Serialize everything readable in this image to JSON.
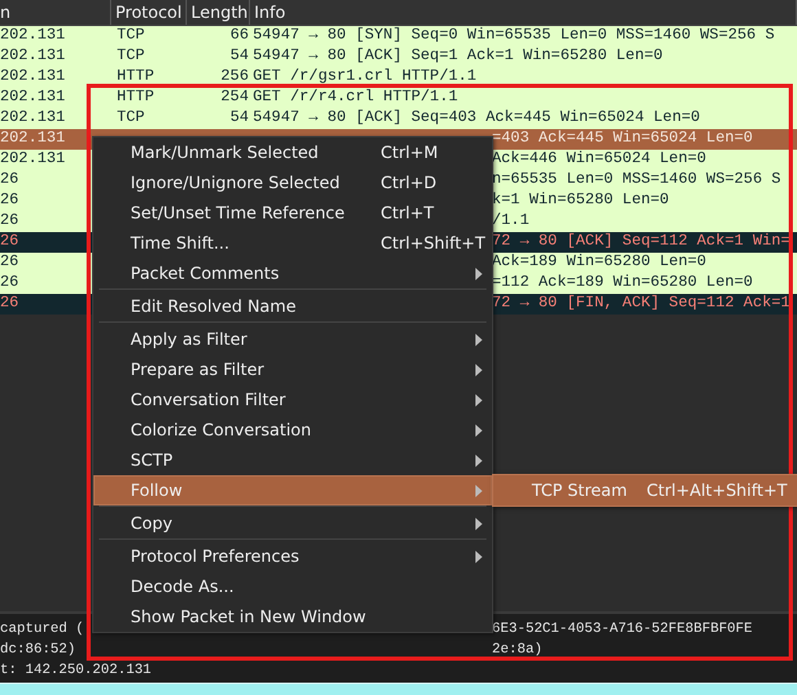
{
  "packet_list": {
    "columns": [
      "n",
      "Protocol",
      "Length",
      "Info"
    ],
    "rows": [
      {
        "cells": [
          "202.131",
          "TCP",
          "66",
          "54947 → 80 [SYN] Seq=0 Win=65535 Len=0 MSS=1460 WS=256 S"
        ],
        "color": "#e4ffc7",
        "selected": false
      },
      {
        "cells": [
          "202.131",
          "TCP",
          "54",
          "54947 → 80 [ACK] Seq=1 Ack=1 Win=65280 Len=0"
        ],
        "color": "#e4ffc7",
        "selected": false
      },
      {
        "cells": [
          "202.131",
          "HTTP",
          "256",
          "GET /r/gsr1.crl HTTP/1.1"
        ],
        "color": "#e4ffc7",
        "selected": false
      },
      {
        "cells": [
          "202.131",
          "HTTP",
          "254",
          "GET /r/r4.crl HTTP/1.1"
        ],
        "color": "#e4ffc7",
        "selected": false
      },
      {
        "cells": [
          "202.131",
          "TCP",
          "54",
          "54947 → 80 [ACK] Seq=403 Ack=445 Win=65024 Len=0"
        ],
        "color": "#e4ffc7",
        "selected": false
      },
      {
        "cells": [
          "202.131",
          "=403 Ack=445 Win=65024 Len=0"
        ],
        "selected": true
      },
      {
        "cells": [
          "202.131",
          "Ack=446 Win=65024 Len=0"
        ],
        "color": "#e4ffc7",
        "selected": false
      },
      {
        "cells": [
          "26",
          "n=65535 Len=0 MSS=1460 WS=256 S"
        ],
        "color": "#e4ffc7",
        "selected": false
      },
      {
        "cells": [
          "26",
          "k=1 Win=65280 Len=0"
        ],
        "color": "#e4ffc7",
        "selected": false
      },
      {
        "cells": [
          "26",
          "/1.1"
        ],
        "color": "#e4ffc7",
        "selected": false
      },
      {
        "cells": [
          "26",
          "72 → 80 [ACK] Seq=112 Ack=1 Win="
        ],
        "color": "#12272e",
        "selected": false
      },
      {
        "cells": [
          "26",
          "Ack=189 Win=65280 Len=0"
        ],
        "color": "#e4ffc7",
        "selected": false
      },
      {
        "cells": [
          "26",
          "=112 Ack=189 Win=65280 Len=0"
        ],
        "color": "#e4ffc7",
        "selected": false
      },
      {
        "cells": [
          "26",
          "72 → 80 [FIN, ACK] Seq=112 Ack=1"
        ],
        "color": "#12272e",
        "selected": false
      }
    ]
  },
  "packet_details": [
    [
      "captured (",
      "6E3-52C1-4053-A716-52FE8BFBF0FE"
    ],
    [
      "dc:86:52)",
      "2e:8a)"
    ],
    [
      "t: 142.250.202.131"
    ]
  ],
  "context_menu": [
    {
      "kind": "item",
      "label": "Mark/Unmark Selected",
      "shortcut": "Ctrl+M",
      "submenu": false,
      "selected": false
    },
    {
      "kind": "item",
      "label": "Ignore/Unignore Selected",
      "shortcut": "Ctrl+D",
      "submenu": false,
      "selected": false
    },
    {
      "kind": "item",
      "label": "Set/Unset Time Reference",
      "shortcut": "Ctrl+T",
      "submenu": false,
      "selected": false
    },
    {
      "kind": "item",
      "label": "Time Shift...",
      "shortcut": "Ctrl+Shift+T",
      "submenu": false,
      "selected": false
    },
    {
      "kind": "item",
      "label": "Packet Comments",
      "submenu": true,
      "selected": false
    },
    {
      "kind": "separator"
    },
    {
      "kind": "item",
      "label": "Edit Resolved Name",
      "submenu": false,
      "selected": false
    },
    {
      "kind": "separator"
    },
    {
      "kind": "item",
      "label": "Apply as Filter",
      "submenu": true,
      "selected": false
    },
    {
      "kind": "item",
      "label": "Prepare as Filter",
      "submenu": true,
      "selected": false
    },
    {
      "kind": "item",
      "label": "Conversation Filter",
      "submenu": true,
      "selected": false
    },
    {
      "kind": "item",
      "label": "Colorize Conversation",
      "submenu": true,
      "selected": false
    },
    {
      "kind": "item",
      "label": "SCTP",
      "submenu": true,
      "selected": false
    },
    {
      "kind": "item",
      "label": "Follow",
      "submenu": true,
      "selected": true,
      "children": [
        {
          "label": "TCP Stream",
          "shortcut": "Ctrl+Alt+Shift+T"
        }
      ]
    },
    {
      "kind": "separator"
    },
    {
      "kind": "item",
      "label": "Copy",
      "submenu": true,
      "selected": false
    },
    {
      "kind": "separator"
    },
    {
      "kind": "item",
      "label": "Protocol Preferences",
      "submenu": true,
      "selected": false
    },
    {
      "kind": "item",
      "label": "Decode As...",
      "submenu": false,
      "selected": false
    },
    {
      "kind": "item",
      "label": "Show Packet in New Window",
      "submenu": false,
      "selected": false
    }
  ]
}
